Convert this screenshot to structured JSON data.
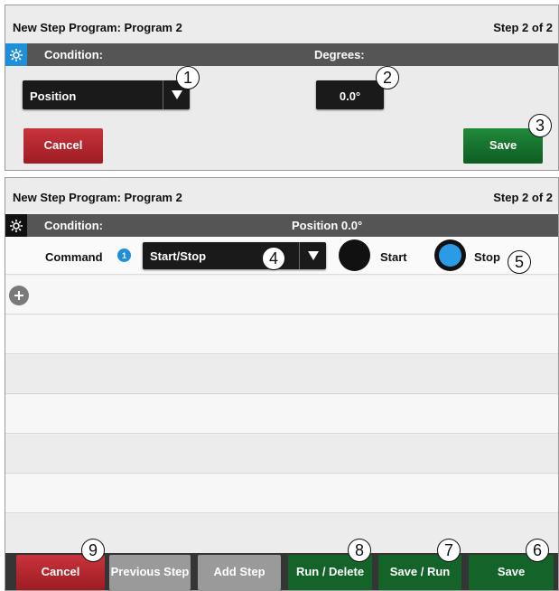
{
  "panel1": {
    "title": "New Step Program:  Program 2",
    "step": "Step 2 of 2",
    "condition_label": "Condition:",
    "degrees_label": "Degrees:",
    "condition_value": "Position",
    "degrees_value": "0.0°",
    "cancel_label": "Cancel",
    "save_label": "Save"
  },
  "panel2": {
    "title": "New Step Program:  Program 2",
    "step": "Step 2 of 2",
    "condition_label": "Condition:",
    "condition_summary": "Position 0.0°",
    "command_label": "Command",
    "command_badge": "1",
    "command_value": "Start/Stop",
    "start_label": "Start",
    "stop_label": "Stop",
    "selected_option": "Stop"
  },
  "bottom_bar": {
    "cancel_label": "Cancel",
    "previous_step_label": "Previous Step",
    "add_step_label": "Add Step",
    "run_delete_label": "Run / Delete",
    "save_run_label": "Save / Run",
    "save_label": "Save"
  },
  "callouts": [
    "1",
    "2",
    "3",
    "4",
    "5",
    "6",
    "7",
    "8",
    "9"
  ],
  "colors": {
    "accent_blue": "#1e8fd8",
    "header_grey": "#555555",
    "cancel_red": "#b0262e",
    "save_green": "#17772f"
  },
  "icons": {
    "gear": "gear-icon",
    "dropdown": "triangle-down-icon",
    "add": "plus-circle-icon",
    "info": "info-badge-icon"
  }
}
